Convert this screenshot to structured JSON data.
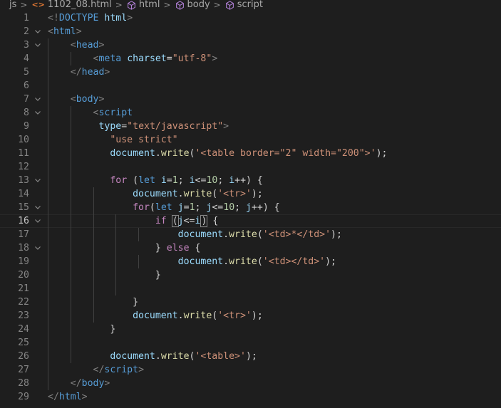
{
  "breadcrumb": {
    "items": [
      {
        "label": "js",
        "icon": ""
      },
      {
        "label": "1102_08.html",
        "icon": "html-file-icon"
      },
      {
        "label": "html",
        "icon": "cube-icon"
      },
      {
        "label": "body",
        "icon": "cube-icon"
      },
      {
        "label": "script",
        "icon": "cube-icon"
      }
    ],
    "separator": ">"
  },
  "theme": {
    "background": "#1e1e1e",
    "tag": "#569cd6",
    "attribute": "#9cdcfe",
    "string": "#ce9178",
    "function": "#dcdcaa",
    "number": "#b5cea8",
    "control": "#c586c0"
  },
  "editor": {
    "active_line": 16,
    "lines": [
      {
        "n": "1",
        "fold": "",
        "guides": [],
        "tokens": [
          [
            "p",
            "<!"
          ],
          [
            "t",
            "DOCTYPE"
          ],
          [
            "x",
            " "
          ],
          [
            "a",
            "html"
          ],
          [
            "p",
            ">"
          ]
        ]
      },
      {
        "n": "2",
        "fold": "v",
        "guides": [],
        "tokens": [
          [
            "p",
            "<"
          ],
          [
            "t",
            "html"
          ],
          [
            "p",
            ">"
          ]
        ]
      },
      {
        "n": "3",
        "fold": "v",
        "guides": [
          0
        ],
        "tokens": [
          [
            "x",
            "    "
          ],
          [
            "p",
            "<"
          ],
          [
            "t",
            "head"
          ],
          [
            "p",
            ">"
          ]
        ]
      },
      {
        "n": "4",
        "fold": "",
        "guides": [
          0,
          1
        ],
        "tokens": [
          [
            "x",
            "        "
          ],
          [
            "p",
            "<"
          ],
          [
            "t",
            "meta"
          ],
          [
            "x",
            " "
          ],
          [
            "a",
            "charset"
          ],
          [
            "x",
            "="
          ],
          [
            "s",
            "\"utf-8\""
          ],
          [
            "p",
            ">"
          ]
        ]
      },
      {
        "n": "5",
        "fold": "",
        "guides": [
          0
        ],
        "tokens": [
          [
            "x",
            "    "
          ],
          [
            "p",
            "</"
          ],
          [
            "t",
            "head"
          ],
          [
            "p",
            ">"
          ]
        ]
      },
      {
        "n": "6",
        "fold": "",
        "guides": [
          0
        ],
        "tokens": []
      },
      {
        "n": "7",
        "fold": "v",
        "guides": [
          0
        ],
        "tokens": [
          [
            "x",
            "    "
          ],
          [
            "p",
            "<"
          ],
          [
            "t",
            "body"
          ],
          [
            "p",
            ">"
          ]
        ]
      },
      {
        "n": "8",
        "fold": "v",
        "guides": [
          0,
          1
        ],
        "tokens": [
          [
            "x",
            "        "
          ],
          [
            "p",
            "<"
          ],
          [
            "t",
            "script"
          ]
        ]
      },
      {
        "n": "9",
        "fold": "",
        "guides": [
          0,
          1
        ],
        "tokens": [
          [
            "x",
            "         "
          ],
          [
            "a",
            "type"
          ],
          [
            "x",
            "="
          ],
          [
            "s",
            "\"text/javascript\""
          ],
          [
            "p",
            ">"
          ]
        ]
      },
      {
        "n": "10",
        "fold": "",
        "guides": [
          0,
          1
        ],
        "tokens": [
          [
            "x",
            "           "
          ],
          [
            "s",
            "\"use strict\""
          ]
        ]
      },
      {
        "n": "11",
        "fold": "",
        "guides": [
          0,
          1
        ],
        "tokens": [
          [
            "x",
            "           "
          ],
          [
            "v",
            "document"
          ],
          [
            "x",
            "."
          ],
          [
            "f",
            "write"
          ],
          [
            "x",
            "("
          ],
          [
            "s",
            "'<table border=\"2\" width=\"200\">'"
          ],
          [
            "x",
            ");"
          ]
        ]
      },
      {
        "n": "12",
        "fold": "",
        "guides": [
          0,
          1
        ],
        "tokens": []
      },
      {
        "n": "13",
        "fold": "v",
        "guides": [
          0,
          1
        ],
        "tokens": [
          [
            "x",
            "           "
          ],
          [
            "c",
            "for"
          ],
          [
            "x",
            " ("
          ],
          [
            "k",
            "let"
          ],
          [
            "x",
            " "
          ],
          [
            "v",
            "i"
          ],
          [
            "x",
            "="
          ],
          [
            "n",
            "1"
          ],
          [
            "x",
            "; "
          ],
          [
            "v",
            "i"
          ],
          [
            "x",
            "<="
          ],
          [
            "n",
            "10"
          ],
          [
            "x",
            "; "
          ],
          [
            "v",
            "i"
          ],
          [
            "x",
            "++) {"
          ]
        ]
      },
      {
        "n": "14",
        "fold": "",
        "guides": [
          0,
          1,
          2
        ],
        "tokens": [
          [
            "x",
            "               "
          ],
          [
            "v",
            "document"
          ],
          [
            "x",
            "."
          ],
          [
            "f",
            "write"
          ],
          [
            "x",
            "("
          ],
          [
            "s",
            "'<tr>'"
          ],
          [
            "x",
            ");"
          ]
        ]
      },
      {
        "n": "15",
        "fold": "v",
        "guides": [
          0,
          1,
          2
        ],
        "tokens": [
          [
            "x",
            "               "
          ],
          [
            "c",
            "for"
          ],
          [
            "x",
            "("
          ],
          [
            "k",
            "let"
          ],
          [
            "x",
            " "
          ],
          [
            "v",
            "j"
          ],
          [
            "x",
            "="
          ],
          [
            "n",
            "1"
          ],
          [
            "x",
            "; "
          ],
          [
            "v",
            "j"
          ],
          [
            "x",
            "<="
          ],
          [
            "n",
            "10"
          ],
          [
            "x",
            "; "
          ],
          [
            "v",
            "j"
          ],
          [
            "x",
            "++) {"
          ]
        ]
      },
      {
        "n": "16",
        "fold": "v",
        "guides": [
          0,
          1,
          2,
          3
        ],
        "tokens": [
          [
            "x",
            "                   "
          ],
          [
            "c",
            "if"
          ],
          [
            "x",
            " "
          ],
          [
            "b",
            "("
          ],
          [
            "v",
            "j"
          ],
          [
            "x",
            "<="
          ],
          [
            "v",
            "i"
          ],
          [
            "cur",
            ""
          ],
          [
            "b",
            ")"
          ],
          [
            "x",
            " {"
          ]
        ]
      },
      {
        "n": "17",
        "fold": "",
        "guides": [
          0,
          1,
          2,
          3,
          4
        ],
        "tokens": [
          [
            "x",
            "                       "
          ],
          [
            "v",
            "document"
          ],
          [
            "x",
            "."
          ],
          [
            "f",
            "write"
          ],
          [
            "x",
            "("
          ],
          [
            "s",
            "'<td>*</td>'"
          ],
          [
            "x",
            ");"
          ]
        ]
      },
      {
        "n": "18",
        "fold": "v",
        "guides": [
          0,
          1,
          2,
          3
        ],
        "tokens": [
          [
            "x",
            "                   "
          ],
          [
            "x",
            "} "
          ],
          [
            "c",
            "else"
          ],
          [
            "x",
            " {"
          ]
        ]
      },
      {
        "n": "19",
        "fold": "",
        "guides": [
          0,
          1,
          2,
          3,
          4
        ],
        "tokens": [
          [
            "x",
            "                       "
          ],
          [
            "v",
            "document"
          ],
          [
            "x",
            "."
          ],
          [
            "f",
            "write"
          ],
          [
            "x",
            "("
          ],
          [
            "s",
            "'<td></td>'"
          ],
          [
            "x",
            ");"
          ]
        ]
      },
      {
        "n": "20",
        "fold": "",
        "guides": [
          0,
          1,
          2,
          3
        ],
        "tokens": [
          [
            "x",
            "                   "
          ],
          [
            "x",
            "}"
          ]
        ]
      },
      {
        "n": "21",
        "fold": "",
        "guides": [
          0,
          1,
          2,
          3
        ],
        "tokens": []
      },
      {
        "n": "22",
        "fold": "",
        "guides": [
          0,
          1,
          2
        ],
        "tokens": [
          [
            "x",
            "               "
          ],
          [
            "x",
            "}"
          ]
        ]
      },
      {
        "n": "23",
        "fold": "",
        "guides": [
          0,
          1,
          2
        ],
        "tokens": [
          [
            "x",
            "               "
          ],
          [
            "v",
            "document"
          ],
          [
            "x",
            "."
          ],
          [
            "f",
            "write"
          ],
          [
            "x",
            "("
          ],
          [
            "s",
            "'<tr>'"
          ],
          [
            "x",
            ");"
          ]
        ]
      },
      {
        "n": "24",
        "fold": "",
        "guides": [
          0,
          1
        ],
        "tokens": [
          [
            "x",
            "           "
          ],
          [
            "x",
            "}"
          ]
        ]
      },
      {
        "n": "25",
        "fold": "",
        "guides": [
          0,
          1
        ],
        "tokens": []
      },
      {
        "n": "26",
        "fold": "",
        "guides": [
          0,
          1
        ],
        "tokens": [
          [
            "x",
            "           "
          ],
          [
            "v",
            "document"
          ],
          [
            "x",
            "."
          ],
          [
            "f",
            "write"
          ],
          [
            "x",
            "("
          ],
          [
            "s",
            "'<table>'"
          ],
          [
            "x",
            ");"
          ]
        ]
      },
      {
        "n": "27",
        "fold": "",
        "guides": [
          0
        ],
        "tokens": [
          [
            "x",
            "        "
          ],
          [
            "p",
            "</"
          ],
          [
            "t",
            "script"
          ],
          [
            "p",
            ">"
          ]
        ]
      },
      {
        "n": "28",
        "fold": "",
        "guides": [
          0
        ],
        "tokens": [
          [
            "x",
            "    "
          ],
          [
            "p",
            "</"
          ],
          [
            "t",
            "body"
          ],
          [
            "p",
            ">"
          ]
        ]
      },
      {
        "n": "29",
        "fold": "",
        "guides": [],
        "tokens": [
          [
            "p",
            "</"
          ],
          [
            "t",
            "html"
          ],
          [
            "p",
            ">"
          ]
        ]
      }
    ]
  }
}
